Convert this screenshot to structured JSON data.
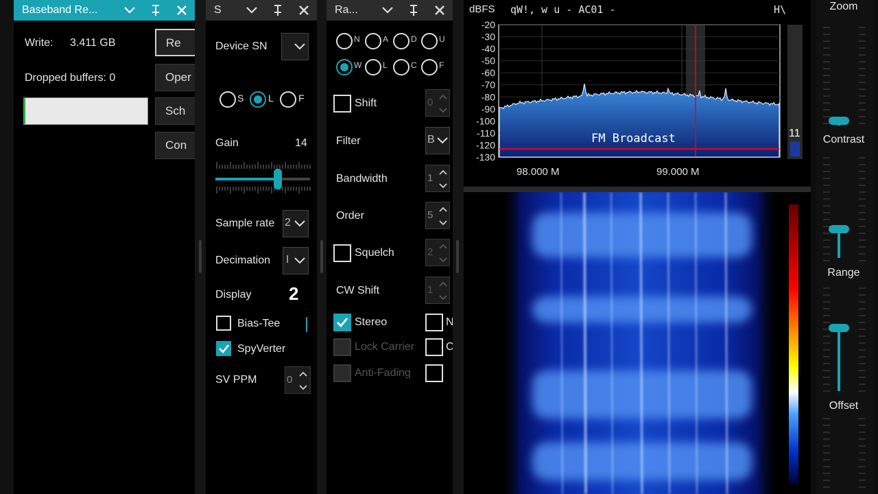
{
  "colors": {
    "accent": "#1aa3b3",
    "header_dark": "#2c2c2c",
    "marker_red": "#e0002a"
  },
  "recorder": {
    "title": "Baseband Re...",
    "write_label": "Write:",
    "write_value": "3.411 GB",
    "dropped_label": "Dropped buffers: 0",
    "buttons": [
      "Re",
      "Oper",
      "Sch",
      "Con"
    ],
    "progress": 0.01
  },
  "source": {
    "title": "S",
    "device_sn_label": "Device SN",
    "radios": [
      {
        "label": "S",
        "on": false
      },
      {
        "label": "L",
        "on": true
      },
      {
        "label": "F",
        "on": false
      }
    ],
    "gain_label": "Gain",
    "gain_value": "14",
    "gain_fraction": 0.66,
    "sample_rate_label": "Sample rate",
    "sample_rate_value": "2",
    "decimation_label": "Decimation",
    "decimation_value": "I",
    "display_label": "Display",
    "display_value": "2",
    "bias_tee_label": "Bias-Tee",
    "spyverter_label": "SpyVerter",
    "sv_ppm_label": "SV PPM",
    "sv_ppm_value": "0"
  },
  "radio": {
    "title": "Ra...",
    "mode_row1": [
      "N",
      "A",
      "D",
      "U"
    ],
    "mode_row2": [
      "W",
      "L",
      "C",
      "F"
    ],
    "shift_label": "Shift",
    "shift_value": "0",
    "filter_label": "Filter",
    "filter_value": "B",
    "bandwidth_label": "Bandwidth",
    "bandwidth_value": "1",
    "order_label": "Order",
    "order_value": "5",
    "squelch_label": "Squelch",
    "squelch_value": "2",
    "cwshift_label": "CW Shift",
    "cwshift_value": "1",
    "stereo_label": "Stereo",
    "lock_carrier_label": "Lock Carrier",
    "anti_fading_label": "Anti-Fading",
    "right_col": [
      "N",
      "C",
      ""
    ]
  },
  "spectrum": {
    "unit_label": "dBFS",
    "station_text": "qW!, w u - AC01 -",
    "corner_text": "H\\",
    "y_ticks": [
      "-20",
      "-30",
      "-40",
      "-50",
      "-60",
      "-70",
      "-80",
      "-90",
      "-100",
      "-110",
      "-120",
      "-130"
    ],
    "x_ticks": [
      "98.000 M",
      "99.000 M"
    ],
    "band_label": "FM Broadcast",
    "meter_value": "11"
  },
  "controls": {
    "zoom_label": "Zoom",
    "contrast_label": "Contrast",
    "range_label": "Range",
    "offset_label": "Offset"
  }
}
